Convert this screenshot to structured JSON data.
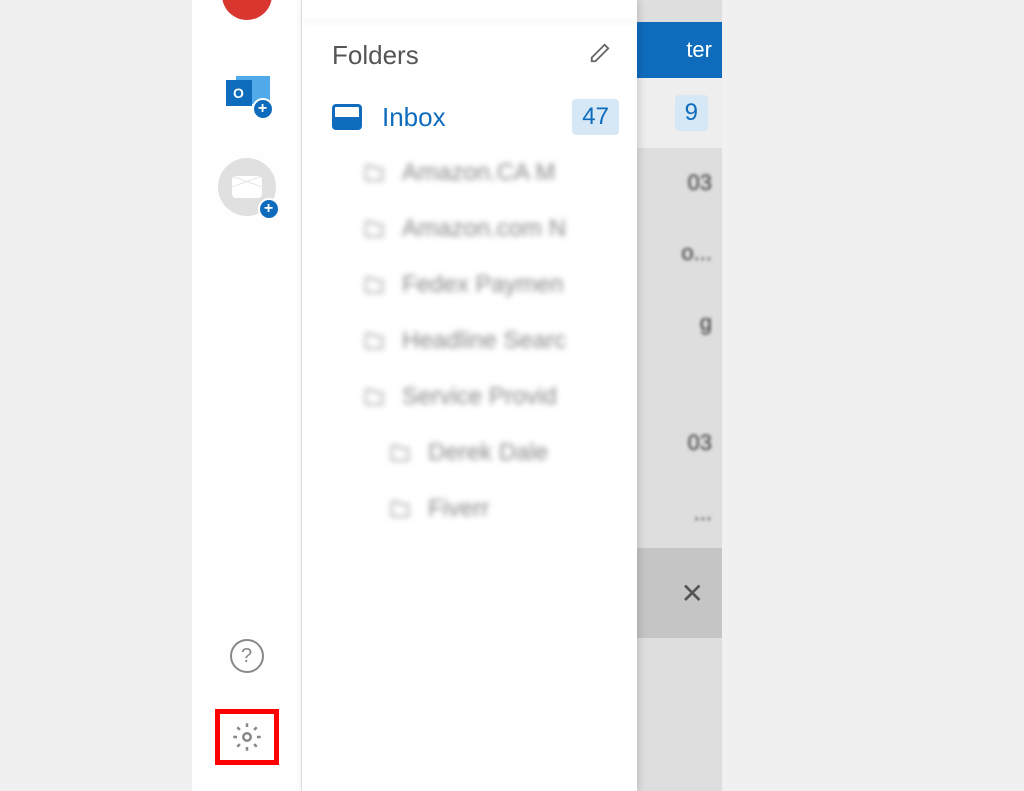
{
  "sidebar": {
    "outlook_letter": "O",
    "plus": "+",
    "help": "?"
  },
  "panel": {
    "folders_title": "Folders",
    "inbox": {
      "label": "Inbox",
      "count": "47"
    },
    "subfolders": [
      "Amazon.CA M",
      "Amazon.com N",
      "Fedex Paymen",
      "Headline Searc",
      "Service Provid"
    ],
    "nested": [
      "Derek Dale",
      "Fiverr"
    ]
  },
  "bg": {
    "header_partial": "ter",
    "badge": "9",
    "snippets": [
      "03",
      "o...",
      "g",
      "03",
      "..."
    ],
    "close": "✕"
  }
}
